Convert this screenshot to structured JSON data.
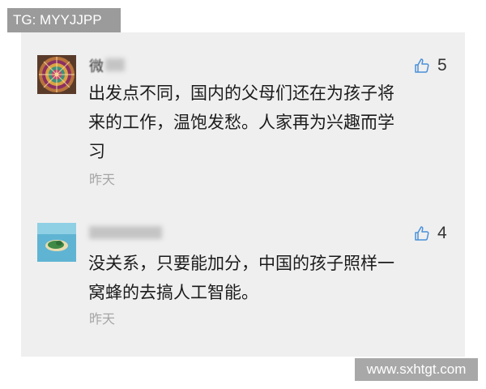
{
  "top_tag": {
    "text": "TG: MYYJJPP"
  },
  "comments": [
    {
      "author_visible": "微",
      "likes": "5",
      "text_lines": [
        "出发点不同，国内的父母们还在为孩子将",
        "来的工作，温饱发愁。人家再为兴趣而学",
        "习"
      ],
      "time": "昨天"
    },
    {
      "likes": "4",
      "text_lines": [
        "没关系，只要能加分，中国的孩子照样一",
        "窝蜂的去搞人工智能。"
      ],
      "time": "昨天"
    }
  ],
  "watermark": {
    "text": "www.sxhtgt.com"
  },
  "colors": {
    "card_bg": "#efefef",
    "text": "#1b1b1b",
    "time": "#a5a5a5",
    "tag_bg": "#9b9b9b",
    "watermark_bg": "#a8a8a8"
  },
  "icons": [
    "mandala-avatar",
    "island-avatar",
    "thumbs-up-icon"
  ]
}
